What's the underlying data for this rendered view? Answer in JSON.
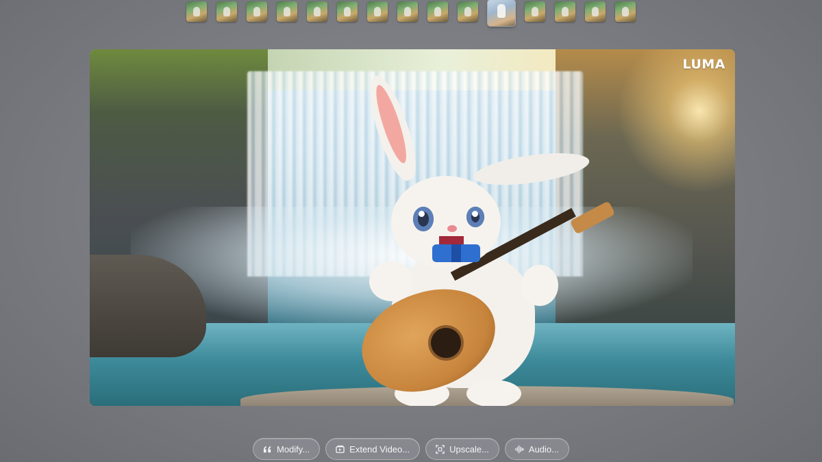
{
  "thumbnails": {
    "count": 15,
    "selected_index": 10
  },
  "video": {
    "watermark": "LUMA",
    "scene": "bunny-playing-guitar-waterfall"
  },
  "actions": [
    {
      "label": "Modify...",
      "icon": "quote-icon"
    },
    {
      "label": "Extend Video...",
      "icon": "extend-video-icon"
    },
    {
      "label": "Upscale...",
      "icon": "upscale-icon"
    },
    {
      "label": "Audio...",
      "icon": "audio-waveform-icon"
    }
  ],
  "colors": {
    "background": "#7d7f84",
    "button_bg": "#96989e",
    "button_text": "#f4f4f6"
  }
}
